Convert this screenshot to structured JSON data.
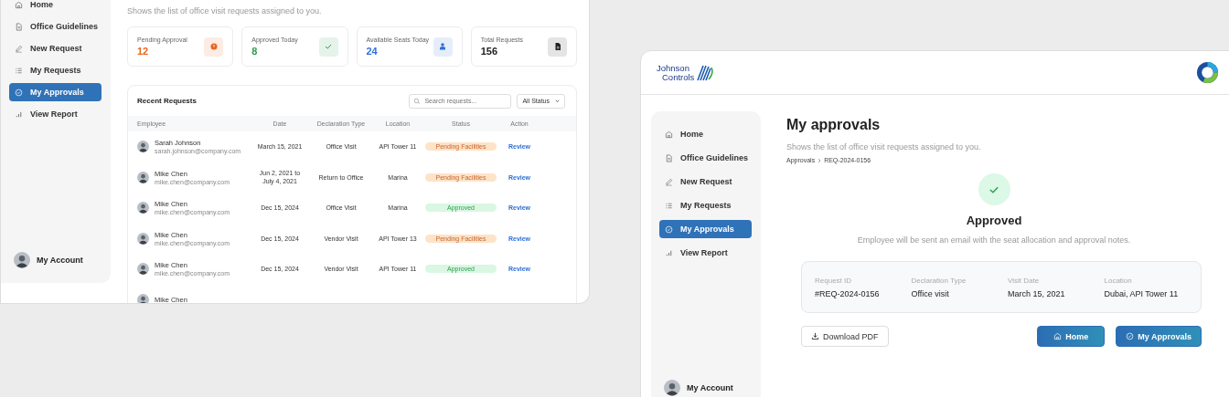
{
  "left_screen": {
    "sidebar": {
      "items": [
        {
          "label": "Home",
          "selected": false
        },
        {
          "label": "Office Guidelines",
          "selected": false
        },
        {
          "label": "New Request",
          "selected": false
        },
        {
          "label": "My Requests",
          "selected": false
        },
        {
          "label": "My Approvals",
          "selected": true
        },
        {
          "label": "View Report",
          "selected": false
        }
      ],
      "account": "My Account"
    },
    "subtitle": "Shows the list of office visit requests assigned to you.",
    "stats": [
      {
        "label": "Pending Approval",
        "value": "12",
        "color": "#e8661c"
      },
      {
        "label": "Approved Today",
        "value": "8",
        "color": "#2e9e4f"
      },
      {
        "label": "Available Seats Today",
        "value": "24",
        "color": "#2f6fd6"
      },
      {
        "label": "Total Requests",
        "value": "156",
        "color": "#222222"
      }
    ],
    "recent_requests": {
      "title": "Recent Requests",
      "search": {
        "placeholder": "Search requests..."
      },
      "filter": "All Status",
      "columns": [
        "Employee",
        "Date",
        "Declaration Type",
        "Location",
        "Status",
        "Action"
      ],
      "rows": [
        {
          "name": "Sarah Johnson",
          "email": "sarah.johnson@company.com",
          "date": "March 15, 2021",
          "type": "Office Visit",
          "location": "API Tower 11",
          "status": {
            "label": "Pending Facilities",
            "kind": "pending"
          },
          "action": "Review"
        },
        {
          "name": "Mike Chen",
          "email": "mike.chen@company.com",
          "date": "Jun 2, 2021 to July 4, 2021",
          "type": "Return to Office",
          "location": "Marina",
          "status": {
            "label": "Pending Facilities",
            "kind": "pending"
          },
          "action": "Review"
        },
        {
          "name": "Mike Chen",
          "email": "mike.chen@company.com",
          "date": "Dec 15, 2024",
          "type": "Office Visit",
          "location": "Marina",
          "status": {
            "label": "Approved",
            "kind": "approved"
          },
          "action": "Review"
        },
        {
          "name": "Mike Chen",
          "email": "mike.chen@company.com",
          "date": "Dec 15, 2024",
          "type": "Vendor Visit",
          "location": "API Tower 13",
          "status": {
            "label": "Pending Facilities",
            "kind": "pending"
          },
          "action": "Review"
        },
        {
          "name": "Mike Chen",
          "email": "mike.chen@company.com",
          "date": "Dec 15, 2024",
          "type": "Vendor Visit",
          "location": "API Tower 11",
          "status": {
            "label": "Approved",
            "kind": "approved"
          },
          "action": "Review"
        },
        {
          "name": "Mike Chen"
        }
      ]
    }
  },
  "right_screen": {
    "logo": {
      "line_1": "Johnson",
      "line_2": "Controls"
    },
    "sidebar": {
      "items": [
        {
          "label": "Home",
          "selected": false
        },
        {
          "label": "Office Guidelines",
          "selected": false
        },
        {
          "label": "New Request",
          "selected": false
        },
        {
          "label": "My Requests",
          "selected": false
        },
        {
          "label": "My Approvals",
          "selected": true
        },
        {
          "label": "View Report",
          "selected": false
        }
      ],
      "account": "My Account"
    },
    "title": "My approvals",
    "subtitle": "Shows the list of office visit requests assigned to you.",
    "breadcrumb": [
      "Approvals",
      "REQ-2024-0156"
    ],
    "result": {
      "status": "Approved",
      "note": "Employee will be sent an email with the seat allocation and approval notes."
    },
    "details": [
      {
        "label": "Request ID",
        "value": "#REQ-2024-0156"
      },
      {
        "label": "Declaration Type",
        "value": "Office visit"
      },
      {
        "label": "Visit Date",
        "value": "March 15, 2021"
      },
      {
        "label": "Location",
        "value": "Dubai, API Tower 11"
      }
    ],
    "buttons": [
      {
        "label": "Download PDF",
        "kind": "outline"
      },
      {
        "label": "Home",
        "kind": "primary"
      },
      {
        "label": "My Approvals",
        "kind": "primary"
      }
    ]
  }
}
